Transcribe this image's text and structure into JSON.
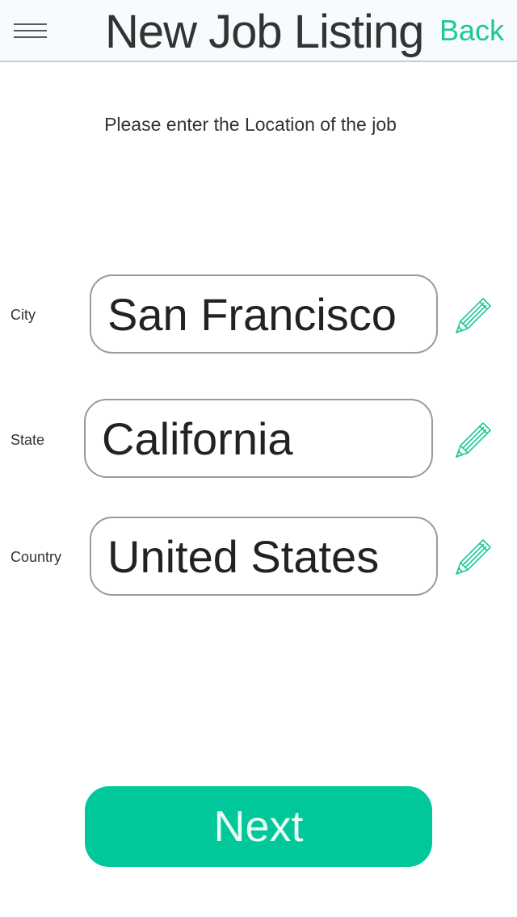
{
  "header": {
    "title": "New Job Listing",
    "back_label": "Back",
    "menu_icon": "hamburger-menu-icon"
  },
  "instruction": "Please enter the Location of the job",
  "fields": [
    {
      "label": "City",
      "value": "San Francisco",
      "icon": "pencil-icon"
    },
    {
      "label": "State",
      "value": "California",
      "icon": "pencil-icon"
    },
    {
      "label": "Country",
      "value": "United States",
      "icon": "pencil-icon"
    }
  ],
  "next_label": "Next",
  "colors": {
    "accent": "#1fc79a",
    "button": "#00c89a",
    "header_bg": "#f7fbfd",
    "field_border": "#9a9a9a"
  }
}
